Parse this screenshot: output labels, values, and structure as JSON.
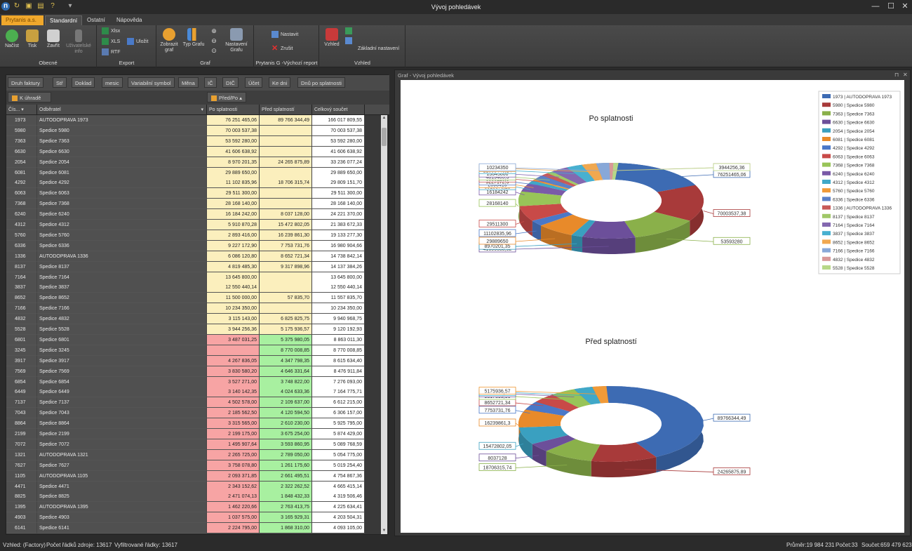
{
  "window": {
    "title": "Vývoj pohledávek"
  },
  "tabs": {
    "app": "Prytanis a.s.",
    "standard": "Standardní",
    "other": "Ostatní",
    "help": "Nápověda"
  },
  "ribbon": {
    "obecne": {
      "label": "Obecné",
      "nacist": "Načíst",
      "tisk": "Tisk",
      "zavrit": "Zavřít",
      "uzivatelske": "Uživatelské info"
    },
    "export": {
      "label": "Export",
      "xlsx": "Xlsx",
      "xls": "XLS",
      "rtf": "RTF",
      "ulozit": "Uložit"
    },
    "graf": {
      "label": "Graf",
      "zobrazit": "Zobrazit graf",
      "typ": "Typ Grafu",
      "nastaveni": "Nastavení Grafu"
    },
    "report": {
      "label": "Prytanis G -Výchozí report",
      "nastavit": "Nastavit",
      "zrusit": "Zrušit"
    },
    "vzhled": {
      "label": "Vzhled",
      "vzhled": "Vzhled",
      "zakladni": "Základní nastavení"
    }
  },
  "filters": [
    "Druh faktury",
    "Stř",
    "Doklad",
    "mesic",
    "Variabilní symbol",
    "Měna",
    "IČ",
    "DIČ",
    "Účet",
    "Ke dni",
    "Dnů po splatnosti"
  ],
  "actions": {
    "k_uhrade": "K úhradě",
    "pred_po": "Před/Po"
  },
  "columns": {
    "cis": "Čís...",
    "odberatel": "Odběratel",
    "po": "Po splatnosti",
    "pred": "Před splatností",
    "celkem": "Celkový součet"
  },
  "rows": [
    [
      "1973",
      "AUTODOPRAVA 1973",
      "76 251 465,06",
      "89 766 344,49",
      "166 017 809,55"
    ],
    [
      "5980",
      "Spedice 5980",
      "70 003 537,38",
      "",
      "70 003 537,38"
    ],
    [
      "7363",
      "Spedice 7363",
      "53 592 280,00",
      "",
      "53 592 280,00"
    ],
    [
      "6630",
      "Spedice 6630",
      "41 606 638,92",
      "",
      "41 606 638,92"
    ],
    [
      "2054",
      "Spedice 2054",
      "8 970 201,35",
      "24 265 875,89",
      "33 236 077,24"
    ],
    [
      "6081",
      "Spedice 6081",
      "29 889 650,00",
      "",
      "29 889 650,00"
    ],
    [
      "4292",
      "Spedice 4292",
      "11 102 835,96",
      "18 706 315,74",
      "29 809 151,70"
    ],
    [
      "6063",
      "Spedice 6063",
      "29 511 300,00",
      "",
      "29 511 300,00"
    ],
    [
      "7368",
      "Spedice 7368",
      "28 168 140,00",
      "",
      "28 168 140,00"
    ],
    [
      "6240",
      "Spedice 6240",
      "16 184 242,00",
      "8 037 128,00",
      "24 221 370,00"
    ],
    [
      "4312",
      "Spedice 4312",
      "5 910 870,28",
      "15 472 802,05",
      "21 383 672,33"
    ],
    [
      "5760",
      "Spedice 5760",
      "2 893 416,00",
      "16 239 861,30",
      "19 133 277,30"
    ],
    [
      "6336",
      "Spedice 6336",
      "9 227 172,90",
      "7 753 731,76",
      "16 980 904,66"
    ],
    [
      "1336",
      "AUTODOPRAVA 1336",
      "6 086 120,80",
      "8 652 721,34",
      "14 738 842,14"
    ],
    [
      "8137",
      "Spedice 8137",
      "4 819 485,30",
      "9 317 898,96",
      "14 137 384,26"
    ],
    [
      "7164",
      "Spedice 7164",
      "13 645 800,00",
      "",
      "13 645 800,00"
    ],
    [
      "3837",
      "Spedice 3837",
      "12 550 440,14",
      "",
      "12 550 440,14"
    ],
    [
      "8652",
      "Spedice 8652",
      "11 500 000,00",
      "57 835,70",
      "11 557 835,70"
    ],
    [
      "7166",
      "Spedice 7166",
      "10 234 350,00",
      "",
      "10 234 350,00"
    ],
    [
      "4832",
      "Spedice 4832",
      "3 115 143,00",
      "6 825 825,75",
      "9 940 968,75"
    ],
    [
      "5528",
      "Spedice 5528",
      "3 944 256,36",
      "5 175 936,57",
      "9 120 192,93"
    ],
    [
      "6801",
      "Spedice 6801",
      "3 487 031,25",
      "5 375 980,05",
      "8 863 011,30"
    ],
    [
      "3245",
      "Spedice 3245",
      "",
      "8 770 008,85",
      "8 770 008,85"
    ],
    [
      "3917",
      "Spedice 3917",
      "4 267 836,05",
      "4 347 798,35",
      "8 615 634,40"
    ],
    [
      "7569",
      "Spedice 7569",
      "3 830 580,20",
      "4 646 331,64",
      "8 476 911,84"
    ],
    [
      "6854",
      "Spedice 6854",
      "3 527 271,00",
      "3 748 822,00",
      "7 276 093,00"
    ],
    [
      "6449",
      "Spedice 6449",
      "3 140 142,35",
      "4 024 633,36",
      "7 164 775,71"
    ],
    [
      "7137",
      "Spedice 7137",
      "4 502 578,00",
      "2 109 637,00",
      "6 612 215,00"
    ],
    [
      "7043",
      "Spedice 7043",
      "2 185 562,50",
      "4 120 594,50",
      "6 306 157,00"
    ],
    [
      "8864",
      "Spedice 8864",
      "3 315 565,00",
      "2 610 230,00",
      "5 925 795,00"
    ],
    [
      "2199",
      "Spedice 2199",
      "2 199 175,00",
      "3 675 254,00",
      "5 874 429,00"
    ],
    [
      "7072",
      "Spedice 7072",
      "1 495 907,64",
      "3 593 860,95",
      "5 089 768,59"
    ],
    [
      "1321",
      "AUTODOPRAVA 1321",
      "2 265 725,00",
      "2 789 050,00",
      "5 054 775,00"
    ],
    [
      "7627",
      "Spedice 7627",
      "3 758 078,80",
      "1 261 175,60",
      "5 019 254,40"
    ],
    [
      "1105",
      "AUTODOPRAVA 1105",
      "2 093 371,85",
      "2 661 495,51",
      "4 754 867,36"
    ],
    [
      "4471",
      "Spedice 4471",
      "2 343 152,62",
      "2 322 262,52",
      "4 665 415,14"
    ],
    [
      "8825",
      "Spedice 8825",
      "2 471 074,13",
      "1 848 432,33",
      "4 319 506,46"
    ],
    [
      "1395",
      "AUTODOPRAVA 1395",
      "1 462 220,66",
      "2 763 413,75",
      "4 225 634,41"
    ],
    [
      "4903",
      "Spedice 4903",
      "1 037 575,00",
      "3 165 929,31",
      "4 203 504,31"
    ],
    [
      "6141",
      "Spedice 6141",
      "2 224 795,00",
      "1 868 310,00",
      "4 093 105,00"
    ]
  ],
  "chart_panel_title": "Graf - Vývoj pohledávek",
  "chart_data": [
    {
      "type": "pie",
      "title": "Po splatnosti",
      "labels": [
        "76251465,06",
        "70003537,38",
        "53593280",
        "41606638,92",
        "8970201,35",
        "29889650",
        "11102835,96",
        "29511300",
        "28168140",
        "16184242",
        "5910870,28",
        "2893416",
        "9227172,9",
        "6086120,8",
        "4819485,3",
        "13645800",
        "12550440,14",
        "11500000",
        "10234350",
        "3115143",
        "3944256,36"
      ],
      "values": [
        76251465.06,
        70003537.38,
        53592280,
        41606638.92,
        8970201.35,
        29889650,
        11102835.96,
        29511300,
        28168140,
        16184242,
        5910870.28,
        2893416,
        9227172.9,
        6086120.8,
        4819485.3,
        13645800,
        12550440.14,
        11500000,
        10234350,
        3115143,
        3944256.36
      ]
    },
    {
      "type": "pie",
      "title": "Před splatností",
      "labels": [
        "89766344,49",
        "24265875,89",
        "18706315,74",
        "8037128",
        "15472802,05",
        "16239861,3",
        "7753731,76",
        "8652721,34",
        "9317898,96",
        "57835,7",
        "6825825,75",
        "5175936,57"
      ],
      "values": [
        89766344.49,
        24265875.89,
        18706315.74,
        8037128,
        15472802.05,
        16239861.3,
        7753731.76,
        8652721.34,
        9317898.96,
        57835.7,
        6825825.75,
        5175936.57
      ]
    }
  ],
  "legend": [
    "1973 | AUTODOPRAVA 1973",
    "5980 | Spedice 5980",
    "7363 | Spedice 7363",
    "6630 | Spedice 6630",
    "2054 | Spedice 2054",
    "6081 | Spedice 6081",
    "4292 | Spedice 4292",
    "6063 | Spedice 6063",
    "7368 | Spedice 7368",
    "6240 | Spedice 6240",
    "4312 | Spedice 4312",
    "5760 | Spedice 5760",
    "6336 | Spedice 6336",
    "1336 | AUTODOPRAVA 1336",
    "8137 | Spedice 8137",
    "7164 | Spedice 7164",
    "3837 | Spedice 3837",
    "8652 | Spedice 8652",
    "7166 | Spedice 7166",
    "4832 | Spedice 4832",
    "5528 | Spedice 5528"
  ],
  "colors": [
    "#3d6bb3",
    "#a83a3a",
    "#8ab04a",
    "#6c4f9a",
    "#3aa0c0",
    "#e88a2a",
    "#4a78c8",
    "#c84a48",
    "#98c458",
    "#7a5aa8",
    "#40a8c8",
    "#f09a38",
    "#5a80c8",
    "#c85a58",
    "#a0c868",
    "#8468b0",
    "#48b0d0",
    "#f0a850",
    "#88a8d8",
    "#d89898",
    "#b8d888"
  ],
  "status": {
    "view": "Vzhled: (Factory)",
    "rows_source": "Počet řádků zdroje: 13617",
    "rows_filtered": "Vyfiltrované řádky: 13617",
    "avg": "Průměr:19 984 231",
    "count": "Počet:33",
    "sum": "Součet:659 479 623"
  }
}
